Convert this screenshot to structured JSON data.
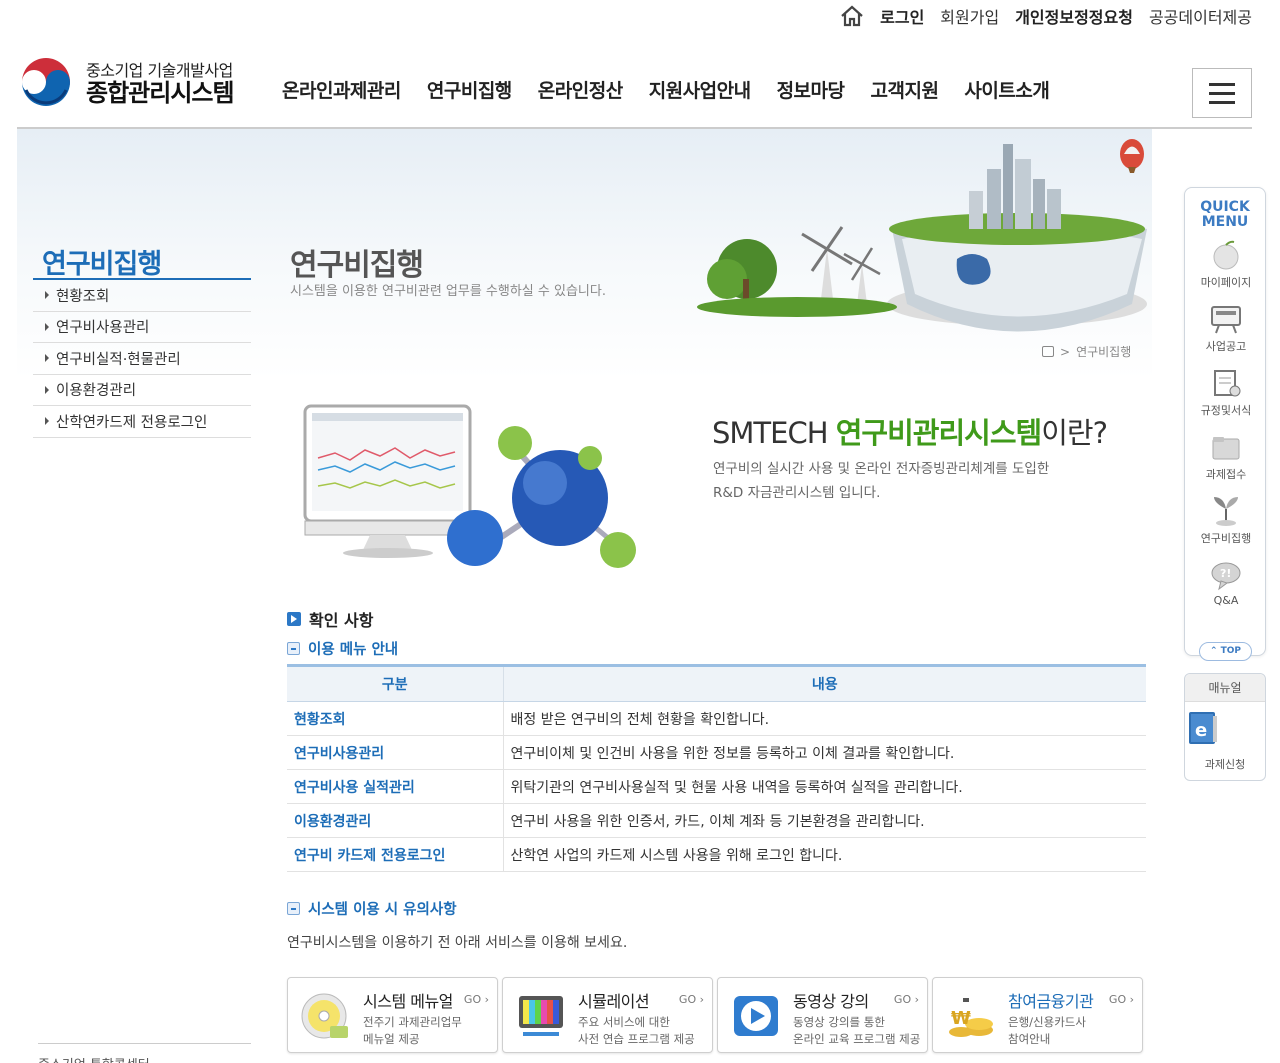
{
  "util": {
    "items": [
      {
        "label": "로그인",
        "strong": true
      },
      {
        "label": "회원가입",
        "strong": false
      },
      {
        "label": "개인정보정정요청",
        "strong": true
      },
      {
        "label": "공공데이터제공",
        "strong": false
      }
    ]
  },
  "logo": {
    "line1": "중소기업 기술개발사업",
    "line2": "종합관리시스템"
  },
  "gnb": {
    "items": [
      "온라인과제관리",
      "연구비집행",
      "온라인정산",
      "지원사업안내",
      "정보마당",
      "고객지원",
      "사이트소개"
    ]
  },
  "sidebar": {
    "title": "연구비집행",
    "items": [
      "현황조회",
      "연구비사용관리",
      "연구비실적·현물관리",
      "이용환경관리",
      "산학연카드제 전용로그인"
    ],
    "footer": "중소기업 통합콜센터"
  },
  "page": {
    "title": "연구비집행",
    "subtitle": "시스템을 이용한 연구비관련 업무를 수행하실 수 있습니다.",
    "breadcrumb": "연구비집행"
  },
  "intro": {
    "title_prefix": "SMTECH ",
    "title_highlight": "연구비관리시스템",
    "title_suffix": "이란?",
    "desc_line1": "연구비의 실시간 사용 및 온라인 전자증빙관리체계를 도입한",
    "desc_line2": "R&D 자금관리시스템 입니다."
  },
  "check": {
    "heading": "확인 사항",
    "menu_heading": "이용 메뉴 안내",
    "table": {
      "headers": [
        "구분",
        "내용"
      ],
      "rows": [
        {
          "name": "현황조회",
          "desc": "배정 받은 연구비의 전체 현황을 확인합니다."
        },
        {
          "name": "연구비사용관리",
          "desc": "연구비이체 및 인건비 사용을 위한 정보를 등록하고 이체 결과를 확인합니다."
        },
        {
          "name": "연구비사용 실적관리",
          "desc": "위탁기관의 연구비사용실적 및 현물 사용 내역을 등록하여 실적을 관리합니다."
        },
        {
          "name": "이용환경관리",
          "desc": "연구비 사용을 위한 인증서, 카드, 이체 계좌 등 기본환경을 관리합니다."
        },
        {
          "name": "연구비 카드제 전용로그인",
          "desc": "산학연 사업의 카드제 시스템 사용을 위해 로그인 합니다."
        }
      ]
    },
    "notice_heading": "시스템 이용 시 유의사항",
    "notice_text": "연구비시스템을 이용하기 전 아래 서비스를 이용해 보세요."
  },
  "services": [
    {
      "title": "시스템 메뉴얼",
      "line1": "전주기 과제관리업무",
      "line2": "메뉴얼 제공",
      "go": "GO ›",
      "icon": "cd-disc-icon",
      "blue": false
    },
    {
      "title": "시뮬레이션",
      "line1": "주요 서비스에 대한",
      "line2": "사전 연습 프로그램 제공",
      "go": "GO ›",
      "icon": "tv-test-icon",
      "blue": false
    },
    {
      "title": "동영상 강의",
      "line1": "동영상 강의를 통한",
      "line2": "온라인 교육 프로그램 제공",
      "go": "GO ›",
      "icon": "play-video-icon",
      "blue": false
    },
    {
      "title": "참여금융기관",
      "line1": "은행/신용카드사",
      "line2": "참여안내",
      "go": "GO ›",
      "icon": "won-coins-icon",
      "blue": true
    }
  ],
  "quick": {
    "title_line1": "QUICK",
    "title_line2": "MENU",
    "items": [
      {
        "label": "마이페이지",
        "icon": "apple-icon"
      },
      {
        "label": "사업공고",
        "icon": "board-icon"
      },
      {
        "label": "규정및서식",
        "icon": "document-icon"
      },
      {
        "label": "과제접수",
        "icon": "folder-icon"
      },
      {
        "label": "연구비집행",
        "icon": "sprout-icon"
      },
      {
        "label": "Q&A",
        "icon": "speech-bubble-icon"
      }
    ],
    "top_label": "⌃ TOP",
    "manual_heading": "매뉴얼",
    "manual_label": "과제신청"
  },
  "colors": {
    "brand_blue": "#1d6db7",
    "accent_green": "#3f9a1a"
  }
}
